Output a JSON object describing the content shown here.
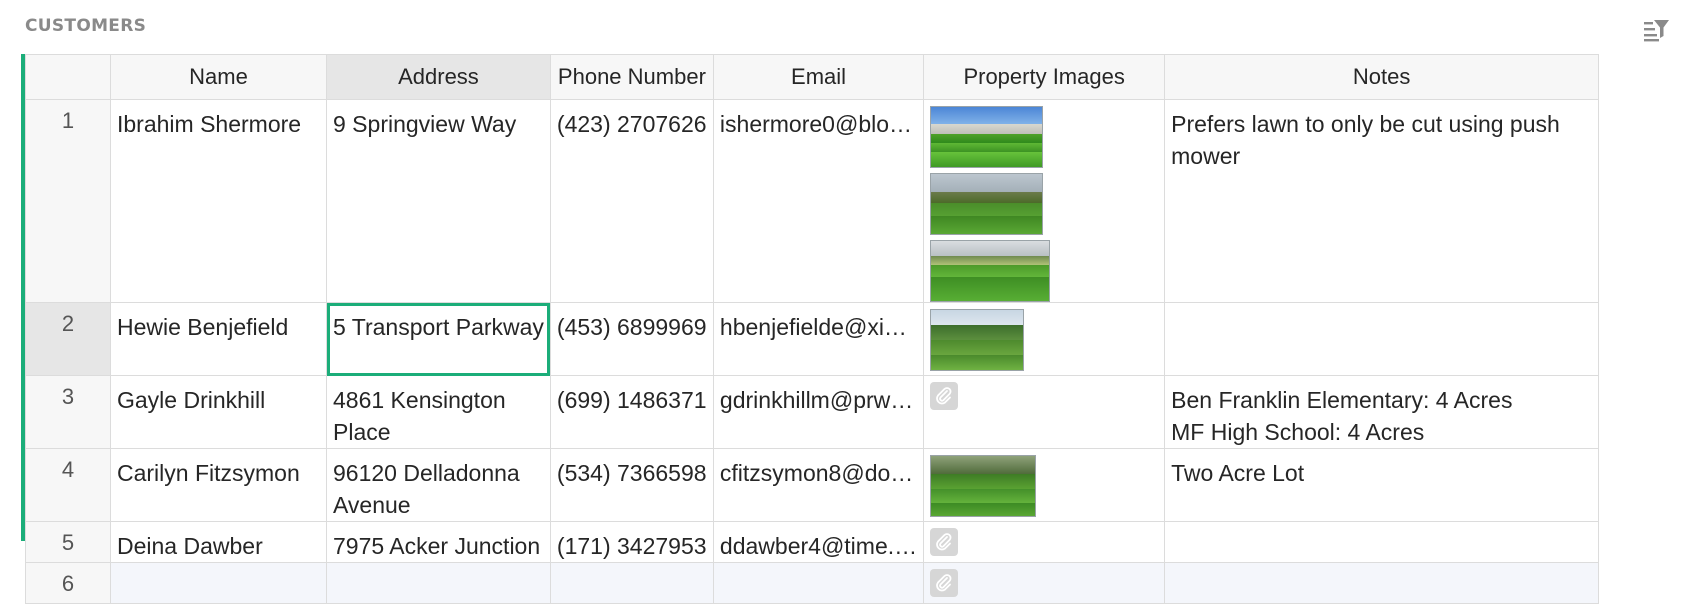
{
  "section": {
    "title": "CUSTOMERS",
    "toolbar_icon": "sort-filter-icon"
  },
  "colors": {
    "accent": "#1bad79",
    "header_bg": "#f7f7f7",
    "active_header_bg": "#e6e6e6",
    "new_row_bg": "#f4f6fb"
  },
  "columns": {
    "name": "Name",
    "address": "Address",
    "phone": "Phone Number",
    "email": "Email",
    "images": "Property Images",
    "notes": "Notes"
  },
  "rows": [
    {
      "num": "1",
      "name": "Ibrahim Shermore",
      "address": "9 Springview Way",
      "phone": "(423) 2707626",
      "email": "ishermore0@blo…",
      "notes": "Prefers lawn to only be cut using push mower",
      "images": 3
    },
    {
      "num": "2",
      "name": "Hewie Benjefield",
      "address": "5 Transport Parkway",
      "phone": "(453) 6899969",
      "email": "hbenjefielde@xi…",
      "notes": "",
      "images": 1
    },
    {
      "num": "3",
      "name": "Gayle Drinkhill",
      "address": "4861 Kensington Place",
      "phone": "(699) 1486371",
      "email": "gdrinkhillm@prw…",
      "notes_line1": "Ben Franklin Elementary: 4 Acres",
      "notes_line2": "MF High School: 4 Acres",
      "images": 0
    },
    {
      "num": "4",
      "name": "Carilyn Fitzsymon",
      "address": "96120 Delladonna Avenue",
      "phone": "(534) 7366598",
      "email": "cfitzsymon8@do…",
      "notes": "Two Acre Lot",
      "images": 1
    },
    {
      "num": "5",
      "name": "Deina Dawber",
      "address": "7975 Acker Junction",
      "phone": "(171) 3427953",
      "email": "ddawber4@time.…",
      "notes": "",
      "images": 0
    },
    {
      "num": "6",
      "name": "",
      "address": "",
      "phone": "",
      "email": "",
      "notes": "",
      "images": 0
    }
  ]
}
